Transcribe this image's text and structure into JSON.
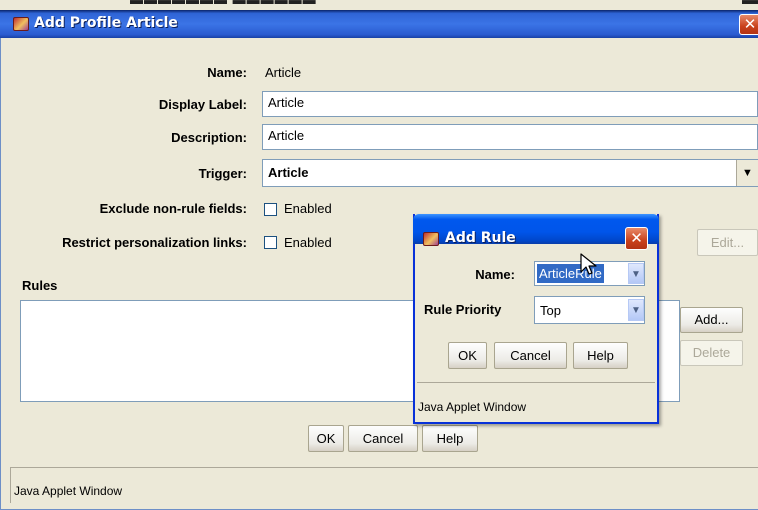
{
  "main_dialog": {
    "title": "Add Profile Article",
    "close_glyph": "✕",
    "fields": {
      "name_label": "Name:",
      "name_value": "Article",
      "display_label_label": "Display Label:",
      "display_label_value": "Article",
      "description_label": "Description:",
      "description_value": "Article",
      "trigger_label": "Trigger:",
      "trigger_value": "Article",
      "exclude_label": "Exclude non-rule fields:",
      "exclude_checkbox_label": "Enabled",
      "restrict_label": "Restrict personalization links:",
      "restrict_checkbox_label": "Enabled"
    },
    "rules_label": "Rules",
    "side_buttons": {
      "edit": "Edit...",
      "add": "Add...",
      "delete": "Delete"
    },
    "bottom_buttons": {
      "ok": "OK",
      "cancel": "Cancel",
      "help": "Help"
    },
    "status": "Java Applet Window"
  },
  "rule_dialog": {
    "title": "Add Rule",
    "close_glyph": "✕",
    "name_label": "Name:",
    "name_value": "ArticleRule",
    "priority_label": "Rule Priority",
    "priority_value": "Top",
    "buttons": {
      "ok": "OK",
      "cancel": "Cancel",
      "help": "Help"
    },
    "status": "Java Applet Window"
  },
  "icons": {
    "dropdown": "chevron-down-icon",
    "app": "applet-icon",
    "close": "close-icon",
    "cursor": "mouse-pointer-icon"
  },
  "colors": {
    "titlebar_blue": "#2f64d6",
    "dialog_titlebar_blue": "#0055ea",
    "close_red": "#c9411c",
    "window_bg": "#ECE9D8",
    "selection_blue": "#316ac5"
  }
}
